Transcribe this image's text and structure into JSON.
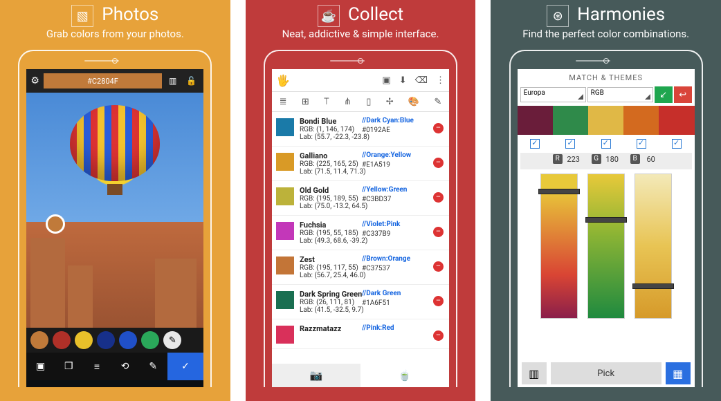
{
  "panels": {
    "photos": {
      "title": "Photos",
      "sub": "Grab colors from your photos.",
      "hex": "#C2804F",
      "swatches": [
        "#c07a3a",
        "#b03028",
        "#e8c02a",
        "#17308a",
        "#2050c8",
        "#2aa85a"
      ]
    },
    "collect": {
      "title": "Collect",
      "sub": "Neat, addictive & simple interface.",
      "rows": [
        {
          "c": "#1a7aa8",
          "nm": "Bondi Blue",
          "rgb": "RGB: (1, 146, 174)",
          "lab": "Lab: (55.7, -22.3, -23.8)",
          "tag": "//Dark Cyan:Blue",
          "hx": "#0192AE"
        },
        {
          "c": "#d99a26",
          "nm": "Galliano",
          "rgb": "RGB: (225, 165, 25)",
          "lab": "Lab: (71.5, 11.4, 71.3)",
          "tag": "//Orange:Yellow",
          "hx": "#E1A519"
        },
        {
          "c": "#bcb23a",
          "nm": "Old Gold",
          "rgb": "RGB: (195, 189, 55)",
          "lab": "Lab: (75.0, -13.2, 64.5)",
          "tag": "//Yellow:Green",
          "hx": "#C3BD37"
        },
        {
          "c": "#c337b9",
          "nm": "Fuchsia",
          "rgb": "RGB: (195, 55, 185)",
          "lab": "Lab: (49.3, 68.6, -39.2)",
          "tag": "//Violet:Pink",
          "hx": "#C337B9"
        },
        {
          "c": "#c37537",
          "nm": "Zest",
          "rgb": "RGB: (195, 117, 55)",
          "lab": "Lab: (56.7, 25.4, 46.0)",
          "tag": "//Brown:Orange",
          "hx": "#C37537"
        },
        {
          "c": "#1a6f51",
          "nm": "Dark Spring Green",
          "rgb": "RGB: (26, 111, 81)",
          "lab": "Lab: (41.5, -32.5, 9.7)",
          "tag": "//Dark Green",
          "hx": "#1A6F51"
        },
        {
          "c": "#d9305a",
          "nm": "Razzmatazz",
          "rgb": "",
          "lab": "",
          "tag": "//Pink:Red",
          "hx": ""
        }
      ]
    },
    "harmonies": {
      "title": "Harmonies",
      "sub": "Find the perfect color combinations.",
      "match": "MATCH & THEMES",
      "sel1": "Europa",
      "sel2": "RGB",
      "palette": [
        "#6a1d3a",
        "#2f8a4a",
        "#e0b846",
        "#d36a1f",
        "#c62f2a"
      ],
      "rgb": {
        "R": "223",
        "G": "180",
        "B": "60"
      },
      "pick": "Pick",
      "thumbs": {
        "R": "10%",
        "G": "30%",
        "B": "76%"
      }
    }
  }
}
